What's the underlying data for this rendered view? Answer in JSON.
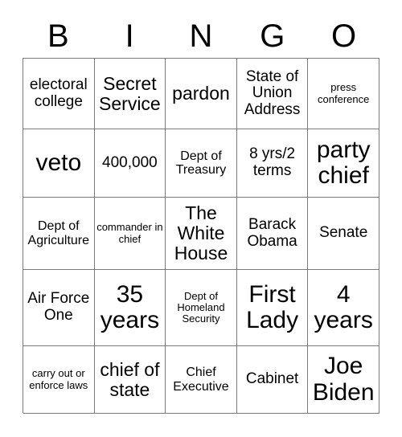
{
  "header": {
    "letters": [
      "B",
      "I",
      "N",
      "G",
      "O"
    ]
  },
  "grid": {
    "rows": [
      [
        {
          "text": "electoral college",
          "size": "sz-m"
        },
        {
          "text": "Secret Service",
          "size": "sz-l"
        },
        {
          "text": "pardon",
          "size": "sz-l"
        },
        {
          "text": "State of Union Address",
          "size": "sz-m"
        },
        {
          "text": "press conference",
          "size": "sz-xs"
        }
      ],
      [
        {
          "text": "veto",
          "size": "sz-xl"
        },
        {
          "text": "400,000",
          "size": "sz-m"
        },
        {
          "text": "Dept of Treasury",
          "size": "sz-s"
        },
        {
          "text": "8 yrs/2 terms",
          "size": "sz-m"
        },
        {
          "text": "party chief",
          "size": "sz-xl"
        }
      ],
      [
        {
          "text": "Dept of Agriculture",
          "size": "sz-s"
        },
        {
          "text": "commander in chief",
          "size": "sz-xs"
        },
        {
          "text": "The White House",
          "size": "sz-l"
        },
        {
          "text": "Barack Obama",
          "size": "sz-m"
        },
        {
          "text": "Senate",
          "size": "sz-m"
        }
      ],
      [
        {
          "text": "Air Force One",
          "size": "sz-m"
        },
        {
          "text": "35 years",
          "size": "sz-xl"
        },
        {
          "text": "Dept of Homeland Security",
          "size": "sz-xs"
        },
        {
          "text": "First Lady",
          "size": "sz-xl"
        },
        {
          "text": "4 years",
          "size": "sz-xl"
        }
      ],
      [
        {
          "text": "carry out or enforce laws",
          "size": "sz-xs"
        },
        {
          "text": "chief of state",
          "size": "sz-l"
        },
        {
          "text": "Chief Executive",
          "size": "sz-s"
        },
        {
          "text": "Cabinet",
          "size": "sz-m"
        },
        {
          "text": "Joe Biden",
          "size": "sz-xl"
        }
      ]
    ]
  }
}
